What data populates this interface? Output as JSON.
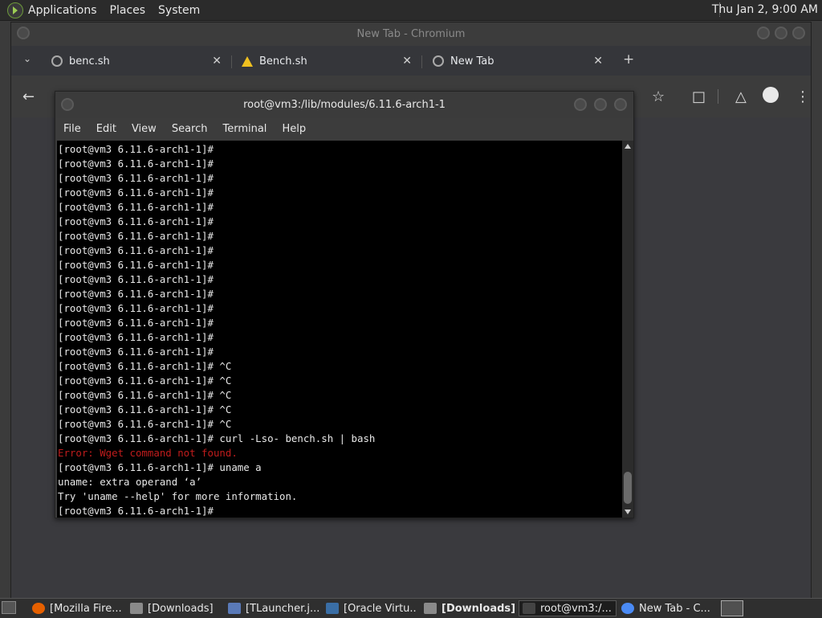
{
  "top_panel": {
    "menus": [
      "Applications",
      "Places",
      "System"
    ],
    "clock": "Thu Jan  2,  9:00 AM"
  },
  "chromium": {
    "title": "New Tab - Chromium",
    "tabs": [
      {
        "label": "benc.sh"
      },
      {
        "label": "Bench.sh"
      },
      {
        "label": "New Tab"
      }
    ],
    "new_tab_glyph": "+",
    "close_glyph": "✕"
  },
  "terminal": {
    "title": "root@vm3:/lib/modules/6.11.6-arch1-1",
    "menu": [
      "File",
      "Edit",
      "View",
      "Search",
      "Terminal",
      "Help"
    ],
    "lines": [
      {
        "text": "[root@vm3 6.11.6-arch1-1]#",
        "error": false
      },
      {
        "text": "[root@vm3 6.11.6-arch1-1]#",
        "error": false
      },
      {
        "text": "[root@vm3 6.11.6-arch1-1]#",
        "error": false
      },
      {
        "text": "[root@vm3 6.11.6-arch1-1]#",
        "error": false
      },
      {
        "text": "[root@vm3 6.11.6-arch1-1]#",
        "error": false
      },
      {
        "text": "[root@vm3 6.11.6-arch1-1]#",
        "error": false
      },
      {
        "text": "[root@vm3 6.11.6-arch1-1]#",
        "error": false
      },
      {
        "text": "[root@vm3 6.11.6-arch1-1]#",
        "error": false
      },
      {
        "text": "[root@vm3 6.11.6-arch1-1]#",
        "error": false
      },
      {
        "text": "[root@vm3 6.11.6-arch1-1]#",
        "error": false
      },
      {
        "text": "[root@vm3 6.11.6-arch1-1]#",
        "error": false
      },
      {
        "text": "[root@vm3 6.11.6-arch1-1]#",
        "error": false
      },
      {
        "text": "[root@vm3 6.11.6-arch1-1]#",
        "error": false
      },
      {
        "text": "[root@vm3 6.11.6-arch1-1]#",
        "error": false
      },
      {
        "text": "[root@vm3 6.11.6-arch1-1]#",
        "error": false
      },
      {
        "text": "[root@vm3 6.11.6-arch1-1]# ^C",
        "error": false
      },
      {
        "text": "[root@vm3 6.11.6-arch1-1]# ^C",
        "error": false
      },
      {
        "text": "[root@vm3 6.11.6-arch1-1]# ^C",
        "error": false
      },
      {
        "text": "[root@vm3 6.11.6-arch1-1]# ^C",
        "error": false
      },
      {
        "text": "[root@vm3 6.11.6-arch1-1]# ^C",
        "error": false
      },
      {
        "text": "[root@vm3 6.11.6-arch1-1]# curl -Lso- bench.sh | bash",
        "error": false
      },
      {
        "text": "Error: Wget command not found.",
        "error": true
      },
      {
        "text": "[root@vm3 6.11.6-arch1-1]# uname a",
        "error": false
      },
      {
        "text": "uname: extra operand ‘a’",
        "error": false
      },
      {
        "text": "Try 'uname --help' for more information.",
        "error": false
      },
      {
        "text": "[root@vm3 6.11.6-arch1-1]#",
        "error": false
      }
    ]
  },
  "taskbar": {
    "items": [
      {
        "label": "[Mozilla Fire...",
        "icon": "firefox-icon",
        "active": false,
        "bold": false
      },
      {
        "label": "[Downloads]",
        "icon": "folder-icon",
        "active": false,
        "bold": false
      },
      {
        "label": "[TLauncher.j...",
        "icon": "java-icon",
        "active": false,
        "bold": false
      },
      {
        "label": "[Oracle Virtu...",
        "icon": "virtualbox-icon",
        "active": false,
        "bold": false
      },
      {
        "label": "[Downloads]",
        "icon": "folder-icon",
        "active": false,
        "bold": true
      },
      {
        "label": "root@vm3:/...",
        "icon": "terminal-icon",
        "active": true,
        "bold": false
      },
      {
        "label": "New Tab - C...",
        "icon": "chromium-icon",
        "active": false,
        "bold": false
      }
    ]
  },
  "colors": {
    "terminal_bg": "#000000",
    "terminal_fg": "#e8e8e8",
    "error_red": "#c01c1c",
    "panel_bg": "#2b2b2b"
  }
}
